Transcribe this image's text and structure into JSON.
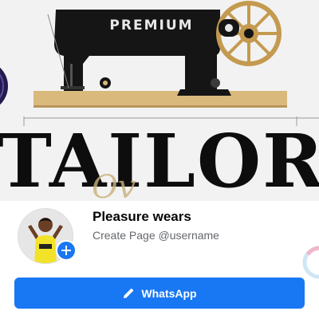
{
  "cover": {
    "premium_label": "PREMIUM",
    "brand_title": "TAILOR",
    "script_overlay": "Ov",
    "colors": {
      "machine": "#151515",
      "wood": "#d9b97c",
      "brand_text": "#0d0d0d"
    }
  },
  "profile": {
    "page_name": "Pleasure wears",
    "subtitle": "Create Page @username",
    "avatar_icon": "profile-photo",
    "add_icon": "plus-icon"
  },
  "actions": {
    "primary_label": "WhatsApp",
    "primary_icon": "pencil-icon",
    "accent": "#1877f2"
  }
}
